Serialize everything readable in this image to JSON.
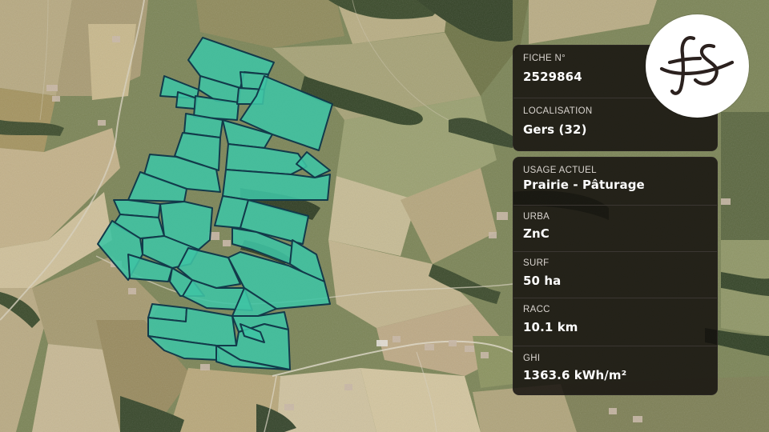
{
  "panel_top": {
    "fiche": {
      "label": "FICHE N°",
      "value": "2529864"
    },
    "localisation": {
      "label": "LOCALISATION",
      "value": "Gers (32)"
    }
  },
  "panel_bottom": {
    "usage": {
      "label": "USAGE ACTUEL",
      "value": "Prairie - Pâturage"
    },
    "urba": {
      "label": "URBA",
      "value": "ZnC"
    },
    "surf": {
      "label": "SURF",
      "value": "50 ha"
    },
    "racc": {
      "label": "RACC",
      "value": "10.1 km"
    },
    "ghi": {
      "label": "GHI",
      "value": "1363.6 kWh/m²"
    }
  },
  "logo": {
    "text": "fs",
    "icon": "fs-monogram-logo"
  },
  "colors": {
    "parcel_fill": "#3fc4a4",
    "parcel_stroke": "#123a4a",
    "panel_bg": "#141010",
    "logo_bg": "#ffffff",
    "logo_ink": "#2b211e"
  }
}
